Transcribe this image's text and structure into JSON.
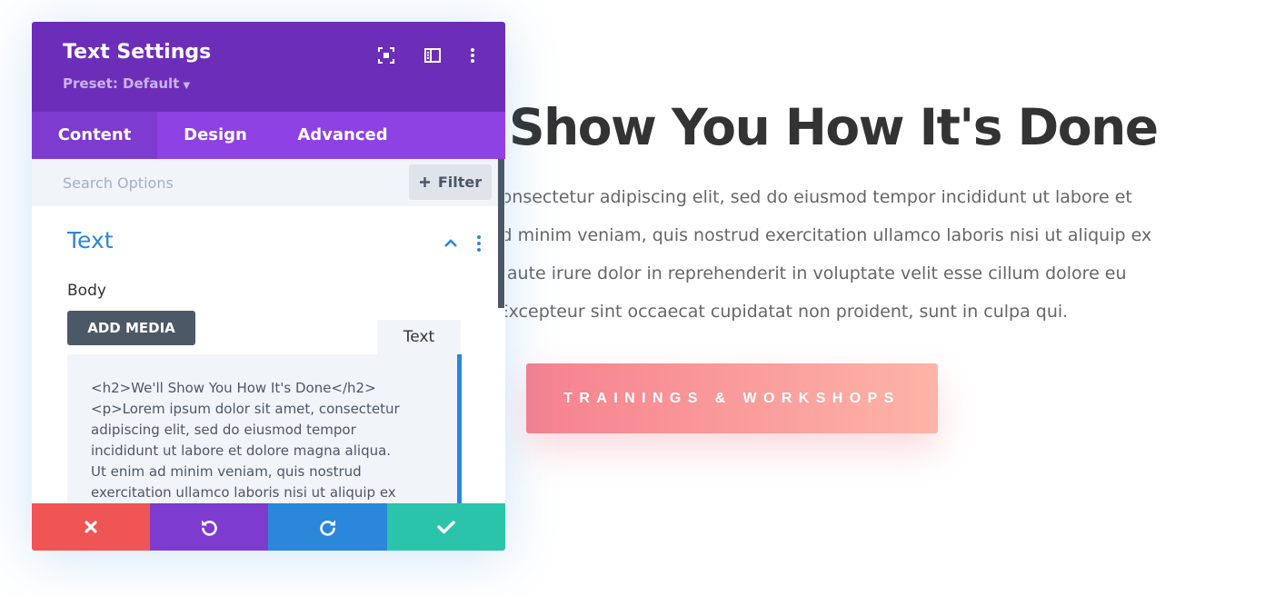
{
  "page": {
    "heading": "Show You How It's Done",
    "paragraph_lines": [
      "et, consectetur adipiscing elit, sed do eiusmod tempor incididunt ut labore et",
      "im ad minim veniam, quis nostrud exercitation ullamco laboris nisi ut aliquip ex",
      "Duis aute irure dolor in reprehenderit in voluptate velit esse cillum dolore eu",
      "tur. Excepteur sint occaecat cupidatat non proident, sunt in culpa qui."
    ],
    "cta_label": "TRAININGS & WORKSHOPS"
  },
  "panel": {
    "title": "Text Settings",
    "preset": "Preset: Default",
    "header_icons": [
      "focus-mode-icon",
      "sidebar-layout-icon",
      "more-vertical-icon"
    ],
    "tabs": [
      {
        "label": "Content",
        "active": true
      },
      {
        "label": "Design",
        "active": false
      },
      {
        "label": "Advanced",
        "active": false
      }
    ],
    "search": {
      "placeholder": "Search Options",
      "filter_label": "Filter"
    },
    "section": {
      "title": "Text",
      "expanded": true
    },
    "body_label": "Body",
    "add_media_label": "ADD MEDIA",
    "editor_tab_label": "Text",
    "editor_lines": [
      "<h2>We'll Show You How It's Done</h2>",
      "<p>Lorem ipsum dolor sit amet, consectetur",
      "adipiscing elit, sed do eiusmod tempor",
      "incididunt ut labore et dolore magna aliqua.",
      "Ut enim ad minim veniam, quis nostrud",
      "exercitation ullamco laboris nisi ut aliquip ex"
    ],
    "footer_actions": [
      {
        "name": "cancel-button",
        "icon": "close-icon",
        "color": "#ef5555"
      },
      {
        "name": "undo-button",
        "icon": "undo-icon",
        "color": "#7e3bd0"
      },
      {
        "name": "redo-button",
        "icon": "redo-icon",
        "color": "#2b87da"
      },
      {
        "name": "save-button",
        "icon": "check-icon",
        "color": "#29c4a9"
      }
    ]
  },
  "colors": {
    "header_purple": "#6c2eb9",
    "tabs_purple": "#8e42e3",
    "accent_blue": "#2b87da",
    "cta_gradient_start": "#f6818f",
    "cta_gradient_end": "#fdb4a7"
  }
}
